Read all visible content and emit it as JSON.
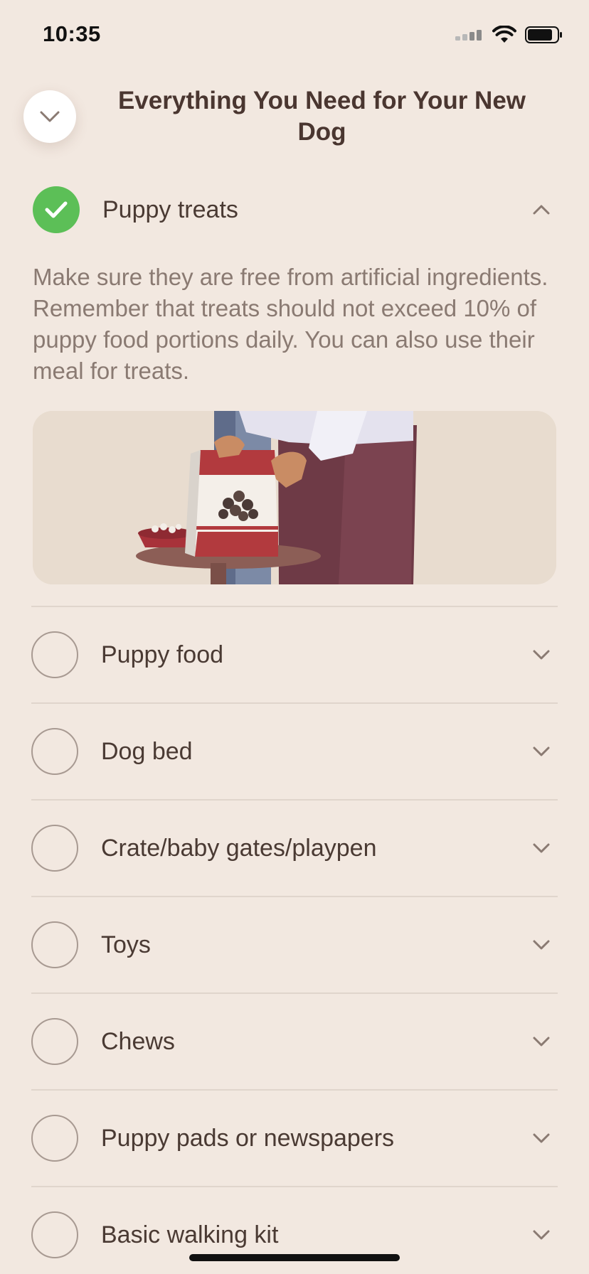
{
  "status_bar": {
    "time": "10:35"
  },
  "header": {
    "title": "Everything You Need for Your New Dog"
  },
  "expanded_item": {
    "label": "Puppy treats",
    "checked": true,
    "description": "Make sure they are free from artificial ingredients. Remember that treats should not exceed 10% of puppy food portions daily. You can also use their meal for treats."
  },
  "items": [
    {
      "label": "Puppy food",
      "checked": false
    },
    {
      "label": "Dog bed",
      "checked": false
    },
    {
      "label": "Crate/baby gates/playpen",
      "checked": false
    },
    {
      "label": "Toys",
      "checked": false
    },
    {
      "label": "Chews",
      "checked": false
    },
    {
      "label": "Puppy pads or newspapers",
      "checked": false
    },
    {
      "label": "Basic walking kit",
      "checked": false
    }
  ],
  "colors": {
    "background": "#f2e8e0",
    "check_green": "#5cbf57",
    "text": "#4a3a33",
    "muted": "#8a7a72"
  },
  "icons": {
    "collapse": "chevron-down-icon",
    "checked": "checkmark-icon",
    "expanded": "chevron-up-icon",
    "collapsed": "chevron-down-icon"
  }
}
